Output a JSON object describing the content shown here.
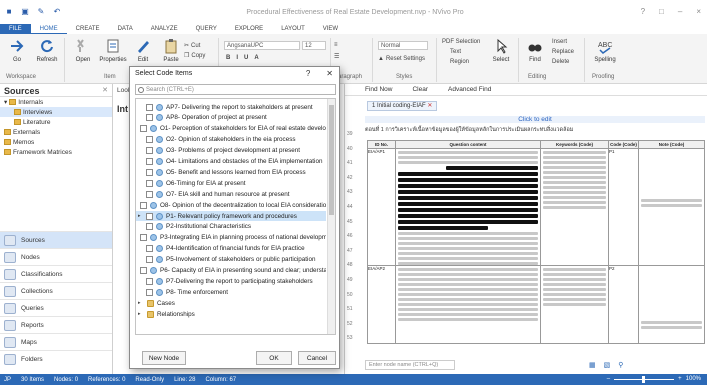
{
  "window": {
    "title": "Procedural Effectiveness of Real Estate Development.nvp - NVivo Pro",
    "controls": [
      "?",
      "□",
      "–",
      "×"
    ]
  },
  "menu": {
    "file": "FILE",
    "tabs": [
      "HOME",
      "CREATE",
      "DATA",
      "ANALYZE",
      "QUERY",
      "EXPLORE",
      "LAYOUT",
      "VIEW"
    ]
  },
  "ribbon": {
    "go": "Go",
    "refresh": "Refresh",
    "open": "Open",
    "properties": "Properties",
    "edit": "Edit",
    "paste": "Paste",
    "cut": "Cut",
    "copy": "Copy",
    "font": "AngsanaUPC",
    "size": "12",
    "style": "Normal",
    "pdf_region": "PDF Selection",
    "text": "Text",
    "region": "Region",
    "reset_settings": "Reset Settings",
    "select": "Select",
    "find": "Find",
    "insert": "Insert",
    "replace": "Replace",
    "delete": "Delete",
    "spelling": "Spelling",
    "groups": {
      "workspace": "Workspace",
      "item": "Item",
      "paragraph": "Paragraph",
      "styles": "Styles",
      "editing": "Editing",
      "proofing": "Proofing"
    }
  },
  "sources": {
    "title": "Sources",
    "tree": [
      {
        "label": "Internals",
        "level": 0
      },
      {
        "label": "Interviews",
        "level": 1
      },
      {
        "label": "Literature",
        "level": 1
      },
      {
        "label": "Externals",
        "level": 0
      },
      {
        "label": "Memos",
        "level": 0
      },
      {
        "label": "Framework Matrices",
        "level": 0
      }
    ],
    "nav": [
      "Sources",
      "Nodes",
      "Classifications",
      "Collections",
      "Queries",
      "Reports",
      "Maps",
      "Folders"
    ]
  },
  "midlist": {
    "head": "Int",
    "col_look": "Look"
  },
  "rightpane": {
    "find_now": "Find Now",
    "clear": "Clear",
    "advanced_find": "Advanced Find",
    "doc_tab": "1 Initial coding-EIAF",
    "click_to_edit": "Click to edit",
    "doc_intro": "ตอนที่ 1 การวิเคราะห์เนื้อหาข้อมูลของผู้ให้ข้อมูลหลักในการประเมินผลกระทบสิ่งแวดล้อม",
    "table_headers": [
      "ID No.",
      "Question content",
      "Keywords (Code)",
      "Code (Code)",
      "Note (Code)"
    ],
    "line_numbers": [
      "39",
      "40",
      "41",
      "42",
      "43",
      "44",
      "45",
      "46",
      "47",
      "48",
      "49",
      "50",
      "51",
      "52",
      "53"
    ],
    "rows": [
      {
        "id": "EIA/AP1",
        "code": "P1",
        "note": ""
      },
      {
        "id": "EIA/AP2",
        "code": "P2",
        "note": ""
      }
    ],
    "node_entry_placeholder": "Enter node name (CTRL+Q)"
  },
  "dialog": {
    "title": "Select Code Items",
    "search_placeholder": "Search (CTRL+E)",
    "items": [
      {
        "label": "AP7- Delivering the report to stakeholders at present",
        "type": "node"
      },
      {
        "label": "AP8- Operation of project at present",
        "type": "node"
      },
      {
        "label": "O1- Perception of stakeholders for EIA of real estate developments",
        "type": "node"
      },
      {
        "label": "O2- Opinion of stakeholders in the eia process",
        "type": "node"
      },
      {
        "label": "O3- Problems of project development at present",
        "type": "node"
      },
      {
        "label": "O4- Limitations and obstacles of the EIA implementation",
        "type": "node"
      },
      {
        "label": "O5- Benefit and lessons learned from EIA process",
        "type": "node"
      },
      {
        "label": "O6-Timing for EIA at present",
        "type": "node"
      },
      {
        "label": "O7- EIA skill and human resource at present",
        "type": "node"
      },
      {
        "label": "O8- Opinion of the decentralization to local EIA consideration",
        "type": "node"
      },
      {
        "label": "P1- Relevant policy framework and procedures",
        "type": "node",
        "selected": true
      },
      {
        "label": "P2-Institutional Characteristics",
        "type": "node"
      },
      {
        "label": "P3-Integrating EIA in planning process of national development",
        "type": "node"
      },
      {
        "label": "P4-Identification of financial funds for EIA practice",
        "type": "node"
      },
      {
        "label": "P5-Involvement of stakeholders or public participation",
        "type": "node"
      },
      {
        "label": "P6- Capacity of EIA in presenting sound and clear; understanding",
        "type": "node"
      },
      {
        "label": "P7-Delivering the report to participating stakeholders",
        "type": "node"
      },
      {
        "label": "P8- Time enforcement",
        "type": "node"
      },
      {
        "label": "Cases",
        "type": "folder"
      },
      {
        "label": "Relationships",
        "type": "folder"
      }
    ],
    "new_node": "New Node",
    "ok": "OK",
    "cancel": "Cancel"
  },
  "status": {
    "user": "JP",
    "items": "30 Items",
    "nodes": "Nodes: 0",
    "references": "References: 0",
    "mode": "Read-Only",
    "line": "Line: 28",
    "column": "Column: 67",
    "zoom": "100%"
  },
  "colors": {
    "accent": "#2c69b6",
    "selection": "#cde3f8"
  }
}
